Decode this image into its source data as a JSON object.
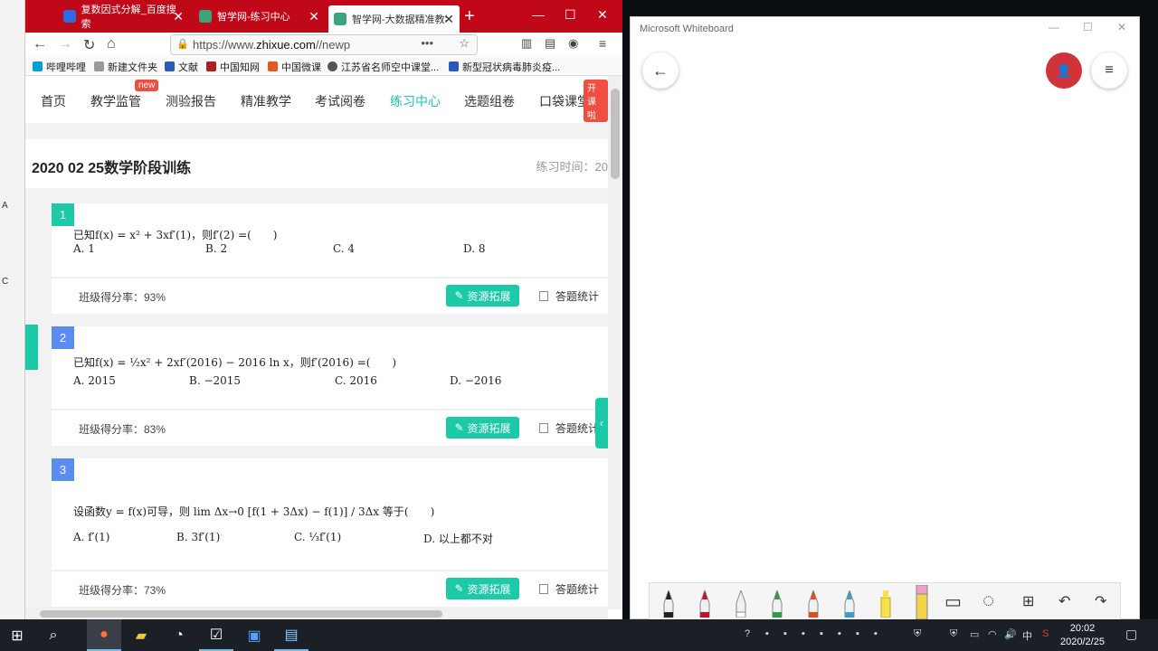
{
  "browser": {
    "tabs": [
      {
        "label": "复数因式分解_百度搜索",
        "color": "#2d6be4"
      },
      {
        "label": "智学网-练习中心",
        "color": "#3aa57a"
      },
      {
        "label": "智学网-大数据精准教学",
        "color": "#3aa57a"
      }
    ],
    "url": {
      "prefix": "https://www.",
      "domain": "zhixue.com",
      "suffix": "//newp"
    },
    "bookmarks": [
      {
        "label": "哔哩哔哩",
        "color": "#00a1d6"
      },
      {
        "label": "新建文件夹",
        "color": "#999"
      },
      {
        "label": "文献",
        "color": "#2a5ab8"
      },
      {
        "label": "中国知网",
        "color": "#b02020"
      },
      {
        "label": "中国微课",
        "color": "#e05a20"
      },
      {
        "label": "江苏省名师空中课堂...",
        "color": "#555"
      },
      {
        "label": "新型冠状病毒肺炎疫...",
        "color": "#2a5ab8"
      }
    ]
  },
  "site": {
    "nav": [
      {
        "label": "首页",
        "active": false
      },
      {
        "label": "教学监管",
        "active": false
      },
      {
        "label": "测验报告",
        "active": false
      },
      {
        "label": "精准教学",
        "active": false
      },
      {
        "label": "考试阅卷",
        "active": false
      },
      {
        "label": "练习中心",
        "active": true
      },
      {
        "label": "选题组卷",
        "active": false
      },
      {
        "label": "口袋课堂",
        "active": false
      }
    ],
    "badge_new": "new",
    "badge_live": "开课啦",
    "page_title": "2020 02 25数学阶段训练",
    "practice_time": "练习时间：20",
    "resource_btn": "资源拓展",
    "stat_btn": "答题统计"
  },
  "questions": [
    {
      "num": "1",
      "color": "#1ccaa8",
      "text": "已知f(x) = x² + 3xf′(1)，则f′(2) =(　　)",
      "options": [
        "A. 1",
        "B. 2",
        "C. 4",
        "D. 8"
      ],
      "rate": "班级得分率：93%"
    },
    {
      "num": "2",
      "color": "#5b8def",
      "text": "已知f(x) = ½x² + 2xf′(2016) − 2016 ln x，则f′(2016) =(　　)",
      "options": [
        "A. 2015",
        "B. −2015",
        "C. 2016",
        "D. −2016"
      ],
      "rate": "班级得分率：83%"
    },
    {
      "num": "3",
      "color": "#5b8def",
      "text": "设函数y = f(x)可导，则 lim Δx→0 [f(1 + 3Δx) − f(1)] / 3Δx 等于(　　)",
      "options": [
        "A. f′(1)",
        "B. 3f′(1)",
        "C. ⅓f′(1)",
        "D. 以上都不对"
      ],
      "rate": "班级得分率：73%"
    }
  ],
  "whiteboard": {
    "title": "Microsoft Whiteboard",
    "pens": [
      "#222222",
      "#c8102e",
      "#ffffff",
      "#2e9a4a",
      "#e04e1a",
      "#3aa0c8",
      "#f5e14a",
      "#f0a0c8"
    ]
  },
  "taskbar": {
    "time": "20:02",
    "date": "2020/2/25",
    "ime": "中"
  },
  "desktop": {
    "left_labels": [
      "A",
      "C"
    ]
  }
}
